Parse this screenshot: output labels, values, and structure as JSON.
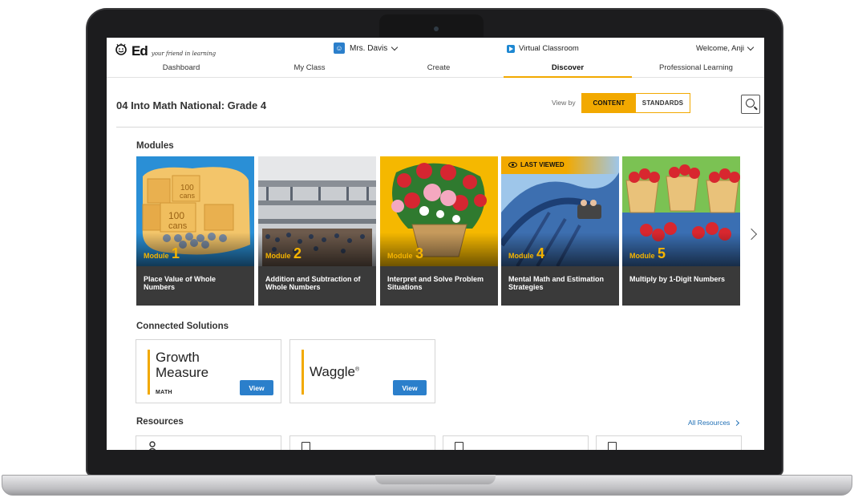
{
  "header": {
    "logo_text": "Ed",
    "logo_tagline": "your friend in learning",
    "user_name": "Mrs. Davis",
    "virtual_classroom": "Virtual Classroom",
    "welcome": "Welcome, Anji"
  },
  "nav": {
    "items": [
      "Dashboard",
      "My Class",
      "Create",
      "Discover",
      "Professional Learning"
    ],
    "active": "Discover"
  },
  "page": {
    "title": "04 Into Math National: Grade 4",
    "view_by_label": "View by",
    "toggle": [
      "CONTENT",
      "STANDARDS"
    ],
    "toggle_selected": "CONTENT"
  },
  "modules": {
    "heading": "Modules",
    "label": "Module",
    "last_viewed": "LAST VIEWED",
    "items": [
      {
        "number": "1",
        "title": "Place Value of Whole Numbers"
      },
      {
        "number": "2",
        "title": "Addition and Subtraction of Whole Numbers"
      },
      {
        "number": "3",
        "title": "Interpret and Solve Problem Situations"
      },
      {
        "number": "4",
        "title": "Mental Math and Estimation Strategies"
      },
      {
        "number": "5",
        "title": "Multiply by 1-Digit Numbers"
      }
    ],
    "art_text": {
      "a": "100",
      "b": "cans"
    }
  },
  "connected": {
    "heading": "Connected Solutions",
    "growth_line1": "Growth",
    "growth_line2": "Measure",
    "growth_sub": "MATH",
    "waggle": "Waggle",
    "waggle_mark": "®",
    "view_label": "View"
  },
  "resources": {
    "heading": "Resources",
    "all_label": "All Resources"
  },
  "colors": {
    "accent": "#f2a900",
    "button_blue": "#2b7fcb",
    "module_card_bg": "#3a3a3a"
  }
}
